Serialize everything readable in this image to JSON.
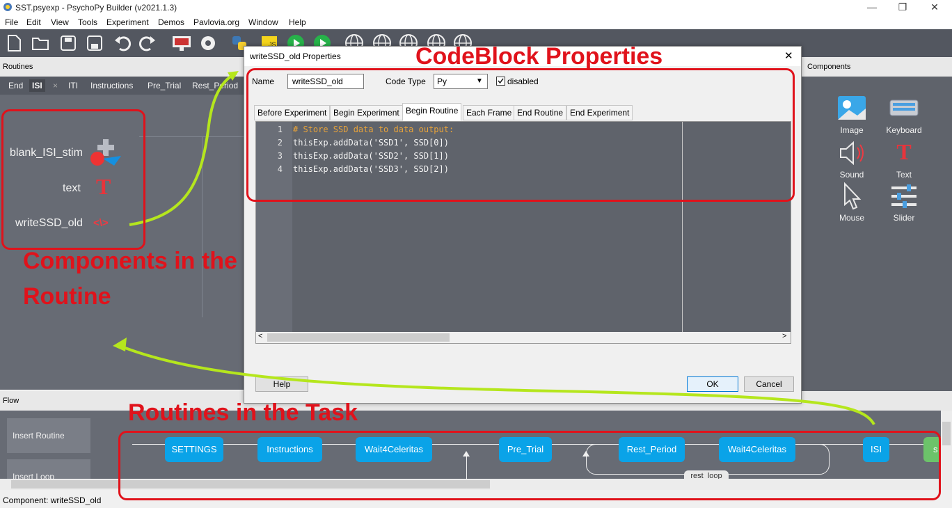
{
  "window": {
    "title": "SST.psyexp - PsychoPy Builder (v2021.1.3)",
    "minimize_glyph": "—",
    "restore_glyph": "❐",
    "close_glyph": "✕"
  },
  "menu": [
    "File",
    "Edit",
    "View",
    "Tools",
    "Experiment",
    "Demos",
    "Pavlovia.org",
    "Window",
    "Help"
  ],
  "panes": {
    "routines_label": "Routines",
    "components_label": "Components",
    "flow_label": "Flow"
  },
  "routine_tabs": [
    "End",
    "ISI",
    "ITI",
    "Instructions",
    "Pre_Trial",
    "Rest_Period"
  ],
  "routine_tab_close": "×",
  "routine_components": [
    {
      "label": "blank_ISI_stim",
      "icon": "image-plus-icon"
    },
    {
      "label": "text",
      "icon": "text-icon"
    },
    {
      "label": "writeSSD_old",
      "icon": "code-icon"
    }
  ],
  "code_glyph": "<\\>",
  "text_glyph": "T",
  "component_palette": [
    {
      "label": "Image",
      "icon": "image-icon"
    },
    {
      "label": "Keyboard",
      "icon": "keyboard-icon"
    },
    {
      "label": "Sound",
      "icon": "sound-icon"
    },
    {
      "label": "Text",
      "icon": "text-icon"
    },
    {
      "label": "Mouse",
      "icon": "mouse-icon"
    },
    {
      "label": "Slider",
      "icon": "slider-icon"
    }
  ],
  "dialog": {
    "title": "writeSSD_old Properties",
    "close_glyph": "✕",
    "name_label": "Name",
    "name_value": "writeSSD_old",
    "code_type_label": "Code Type",
    "code_type_value": "Py",
    "disabled_label": "disabled",
    "disabled_checked": true,
    "tabs": [
      "Before Experiment",
      "Begin Experiment",
      "Begin Routine",
      "Each Frame",
      "End Routine",
      "End Experiment"
    ],
    "active_tab": "Begin Routine",
    "code_lines": [
      {
        "n": "1",
        "text": "# Store SSD data to data output:",
        "kind": "comment"
      },
      {
        "n": "2",
        "text": "thisExp.addData('SSD1', SSD[0])",
        "kind": "code"
      },
      {
        "n": "3",
        "text": "thisExp.addData('SSD2', SSD[1])",
        "kind": "code"
      },
      {
        "n": "4",
        "text": "thisExp.addData('SSD3', SSD[2])",
        "kind": "code"
      }
    ],
    "help_label": "Help",
    "ok_label": "OK",
    "cancel_label": "Cancel"
  },
  "flow": {
    "insert_routine_label": "Insert Routine",
    "insert_loop_label": "Insert Loop",
    "routines": [
      "SETTINGS",
      "Instructions",
      "Wait4Celeritas",
      "Pre_Trial",
      "Rest_Period",
      "Wait4Celeritas",
      "ISI",
      "s"
    ],
    "loop_label": "rest_loop"
  },
  "status": {
    "text": "Component: writeSSD_old"
  },
  "annotations": {
    "codeblock": "CodeBlock Properties",
    "components_line1": "Components in the",
    "components_line2": "Routine",
    "routines": "Routines in the Task"
  },
  "colors": {
    "annotation_red": "#e0121b",
    "arrow_green": "#b5e61d",
    "routine_blue": "#0aa3e8",
    "comment_orange": "#e8a33a"
  }
}
